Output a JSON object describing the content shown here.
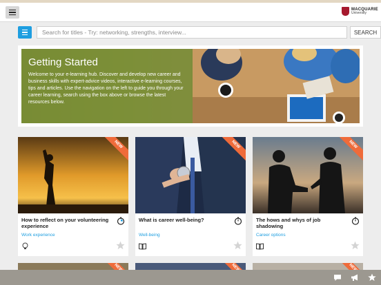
{
  "header": {
    "logo_name": "MACQUARIE",
    "logo_sub": "University"
  },
  "search": {
    "placeholder": "Search for titles - Try: networking, strengths, interview...",
    "button_label": "SEARCH"
  },
  "hero": {
    "title": "Getting Started",
    "description": "Welcome to your e-learning hub. Discover and develop new career and business skills with expert-advice videos, interactive e-learning courses, tips and articles. Use the navigation on the left to guide you through your career learning, search using the box above or browse the latest resources below."
  },
  "cards": [
    {
      "badge": "NEW",
      "title": "How to reflect on your volunteering experience",
      "category": "Work experience",
      "type_icon": "lightbulb-icon"
    },
    {
      "badge": "NEW",
      "title": "What is career well-being?",
      "category": "Well-being",
      "type_icon": "book-icon"
    },
    {
      "badge": "NEW",
      "title": "The hows and whys of job shadowing",
      "category": "Career options",
      "type_icon": "book-icon"
    }
  ],
  "row2_badges": [
    "NEW",
    "NEW",
    "NEW"
  ],
  "colors": {
    "accent": "#1e9ee0",
    "ribbon": "#ef6b3a",
    "hero_panel": "#788c32",
    "bottom_bar": "#9c9890"
  },
  "bottom_bar": {
    "icons": [
      "chat-icon",
      "megaphone-icon",
      "star-icon"
    ]
  }
}
